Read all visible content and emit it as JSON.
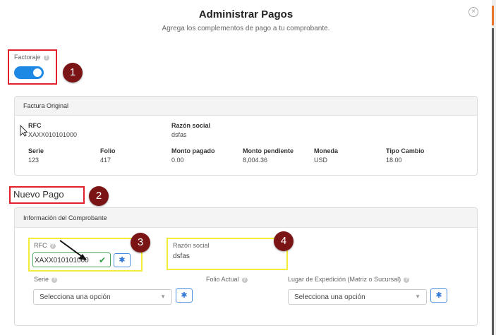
{
  "header": {
    "title": "Administrar Pagos",
    "subtitle": "Agrega los complementos de pago a tu comprobante.",
    "close_icon": "close-circle-icon"
  },
  "factoraje": {
    "label": "Factoraje",
    "help": "?",
    "enabled": true
  },
  "factura_original": {
    "heading": "Factura Original",
    "rfc_label": "RFC",
    "rfc_value": "XAXX010101000",
    "razon_label": "Razón social",
    "razon_value": "dsfas",
    "columns": [
      {
        "label": "Serie",
        "value": "123"
      },
      {
        "label": "Folio",
        "value": "417"
      },
      {
        "label": "Monto pagado",
        "value": "0.00"
      },
      {
        "label": "Monto pendiente",
        "value": "8,004.36"
      },
      {
        "label": "Moneda",
        "value": "USD"
      },
      {
        "label": "Tipo Cambio",
        "value": "18.00"
      }
    ]
  },
  "nuevo_pago": {
    "title": "Nuevo Pago"
  },
  "comprobante": {
    "heading": "Información del Comprobante",
    "rfc_label": "RFC",
    "rfc_value": "XAXX010101000",
    "razon_label": "Razón social",
    "razon_value": "dsfas",
    "serie_label": "Serie",
    "serie_placeholder": "Selecciona una opción",
    "folio_label": "Folio Actual",
    "lugar_label": "Lugar de Expedición (Matriz o Sucursal)",
    "lugar_placeholder": "Selecciona una opción"
  },
  "badges": [
    "1",
    "2",
    "3",
    "4"
  ],
  "colors": {
    "accent": "#1e88e5",
    "badge": "#7b1515",
    "highlight_red": "#e0202a",
    "highlight_yellow": "#f2ec3a",
    "check": "#2e9e45"
  }
}
